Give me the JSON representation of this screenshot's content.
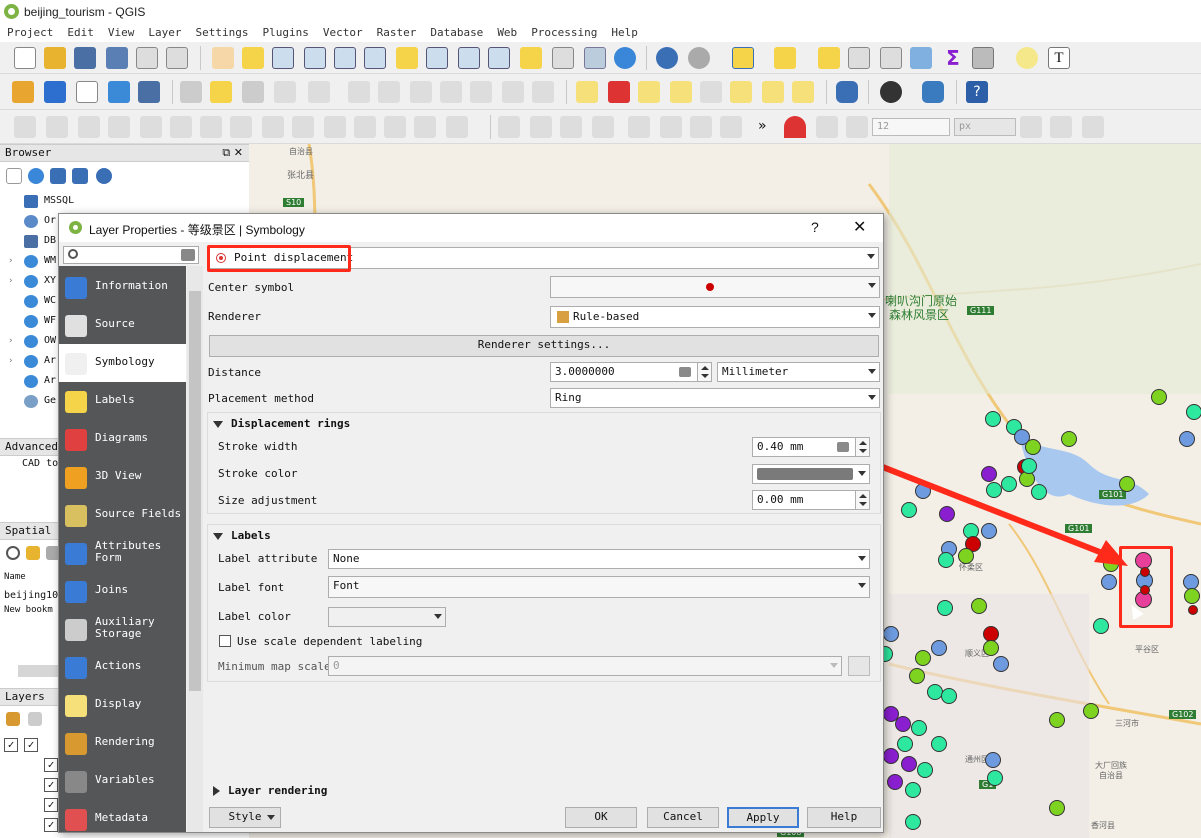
{
  "app": {
    "window_title": "beijing_tourism - QGIS",
    "menu": [
      "Project",
      "Edit",
      "View",
      "Layer",
      "Settings",
      "Plugins",
      "Vector",
      "Raster",
      "Database",
      "Web",
      "Processing",
      "Help"
    ]
  },
  "toolbar": {
    "snap_tolerance": "12",
    "snap_units": "px"
  },
  "browser_panel": {
    "title": "Browser",
    "items": [
      {
        "label": "MSSQL",
        "icon": "mssql-icon"
      },
      {
        "label": "Or",
        "icon": "oracle-icon"
      },
      {
        "label": "DB",
        "icon": "db2-icon"
      },
      {
        "label": "WM",
        "icon": "wms-icon"
      },
      {
        "label": "XY",
        "icon": "xyz-tiles-icon"
      },
      {
        "label": "WC",
        "icon": "wcs-icon"
      },
      {
        "label": "WF",
        "icon": "wfs-icon"
      },
      {
        "label": "OW",
        "icon": "ows-icon"
      },
      {
        "label": "Ar",
        "icon": "arcgis-map-icon"
      },
      {
        "label": "Ar",
        "icon": "arcgis-feature-icon"
      },
      {
        "label": "Ge",
        "icon": "geonode-icon"
      }
    ]
  },
  "advanced_panel": {
    "title": "Advanced",
    "item": "CAD to"
  },
  "spatial_panel": {
    "title": "Spatial B",
    "col_name": "Name",
    "rows": [
      "beijing10",
      "New bookm"
    ]
  },
  "layers_panel": {
    "title": "Layers"
  },
  "dialog": {
    "title": "Layer Properties - 等级景区 | Symbology",
    "help": "?",
    "nav": [
      {
        "label": "Information",
        "icon": "information-icon"
      },
      {
        "label": "Source",
        "icon": "source-icon"
      },
      {
        "label": "Symbology",
        "icon": "symbology-icon",
        "selected": true
      },
      {
        "label": "Labels",
        "icon": "labels-icon"
      },
      {
        "label": "Diagrams",
        "icon": "diagrams-icon"
      },
      {
        "label": "3D View",
        "icon": "3d-view-icon"
      },
      {
        "label": "Source Fields",
        "icon": "source-fields-icon"
      },
      {
        "label": "Attributes\nForm",
        "icon": "attributes-form-icon"
      },
      {
        "label": "Joins",
        "icon": "joins-icon"
      },
      {
        "label": "Auxiliary\nStorage",
        "icon": "auxiliary-storage-icon"
      },
      {
        "label": "Actions",
        "icon": "actions-icon"
      },
      {
        "label": "Display",
        "icon": "display-icon"
      },
      {
        "label": "Rendering",
        "icon": "rendering-icon"
      },
      {
        "label": "Variables",
        "icon": "variables-icon"
      },
      {
        "label": "Metadata",
        "icon": "metadata-icon"
      }
    ],
    "renderer_type": "Point displacement",
    "center_symbol_label": "Center symbol",
    "renderer_label": "Renderer",
    "renderer_value": "Rule-based",
    "renderer_settings_button": "Renderer settings...",
    "distance_label": "Distance",
    "distance_value": "3.0000000",
    "distance_unit": "Millimeter",
    "placement_label": "Placement method",
    "placement_value": "Ring",
    "rings_section": "Displacement rings",
    "stroke_width_label": "Stroke width",
    "stroke_width_value": "0.40 mm",
    "stroke_color_label": "Stroke color",
    "stroke_color": "#7a7a7a",
    "size_adjust_label": "Size adjustment",
    "size_adjust_value": "0.00 mm",
    "labels_section": "Labels",
    "label_attr_label": "Label attribute",
    "label_attr_value": "None",
    "label_font_label": "Label font",
    "label_font_value": "Font",
    "label_color_label": "Label color",
    "scale_dep_label": "Use scale dependent labeling",
    "min_scale_label": "Minimum map scale",
    "min_scale_value": "0",
    "layer_rendering_section": "Layer rendering",
    "buttons": {
      "style": "Style",
      "ok": "OK",
      "cancel": "Cancel",
      "apply": "Apply",
      "help": "Help"
    }
  },
  "map": {
    "labels": [
      "张北县",
      "S10",
      "喇叭沟门原始",
      "森林风景区",
      "G111",
      "G101",
      "G101",
      "怀柔区",
      "平谷区",
      "顺义区",
      "G102",
      "三河市",
      "通州区",
      "大厂回族",
      "自治县",
      "G1",
      "香河县",
      "G108",
      "自治县"
    ],
    "accent_colors": {
      "green": "#7ed321",
      "teal": "#2ee8a0",
      "blue": "#6e9be0",
      "purple": "#8a1fd0",
      "pink": "#e8409a",
      "red": "#cc0000"
    }
  },
  "annotation": {
    "highlight_color": "#ff2a1a"
  }
}
